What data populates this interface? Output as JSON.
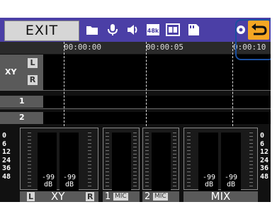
{
  "topbar": {
    "exit_label": "EXIT",
    "icons": [
      "folder-icon",
      "microphone-icon",
      "speaker-icon",
      "sample-rate-icon",
      "timecode-icon",
      "sd-card-icon",
      "settings-icon",
      "back-icon"
    ],
    "sample_rate_badge": "48k"
  },
  "timeline": {
    "timecodes": [
      "00:00:00",
      "00:00:05",
      "0:00:10"
    ],
    "tracks": [
      {
        "name": "XY",
        "l": "L",
        "r": "R"
      },
      {
        "name": "1"
      },
      {
        "name": "2"
      }
    ]
  },
  "meters": {
    "scale": [
      "0",
      "6",
      "12",
      "24",
      "36",
      "48"
    ],
    "xy": {
      "left_db": "-99",
      "right_db": "-99",
      "unit": "dB",
      "label": "XY",
      "l": "L",
      "r": "R"
    },
    "ch1": {
      "num": "1",
      "tag": "MIC"
    },
    "ch2": {
      "num": "2",
      "tag": "MIC"
    },
    "mix": {
      "left_db": "-99",
      "right_db": "-99",
      "unit": "dB",
      "label": "MIX"
    }
  },
  "colors": {
    "accent": "#4b3fa6",
    "back_button": "#f5a623",
    "highlight": "#1a4fa0"
  }
}
